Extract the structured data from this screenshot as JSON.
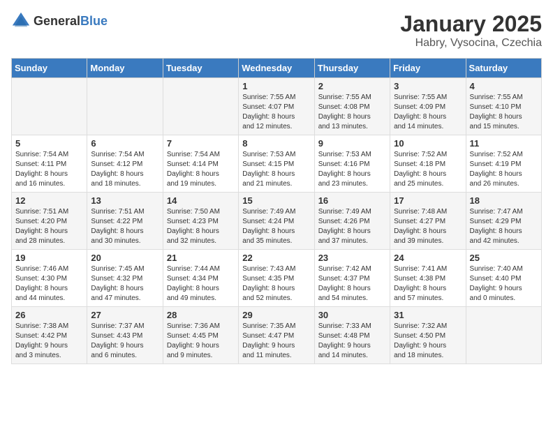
{
  "logo": {
    "text_general": "General",
    "text_blue": "Blue"
  },
  "header": {
    "month": "January 2025",
    "location": "Habry, Vysocina, Czechia"
  },
  "weekdays": [
    "Sunday",
    "Monday",
    "Tuesday",
    "Wednesday",
    "Thursday",
    "Friday",
    "Saturday"
  ],
  "weeks": [
    [
      {
        "day": "",
        "info": ""
      },
      {
        "day": "",
        "info": ""
      },
      {
        "day": "",
        "info": ""
      },
      {
        "day": "1",
        "info": "Sunrise: 7:55 AM\nSunset: 4:07 PM\nDaylight: 8 hours\nand 12 minutes."
      },
      {
        "day": "2",
        "info": "Sunrise: 7:55 AM\nSunset: 4:08 PM\nDaylight: 8 hours\nand 13 minutes."
      },
      {
        "day": "3",
        "info": "Sunrise: 7:55 AM\nSunset: 4:09 PM\nDaylight: 8 hours\nand 14 minutes."
      },
      {
        "day": "4",
        "info": "Sunrise: 7:55 AM\nSunset: 4:10 PM\nDaylight: 8 hours\nand 15 minutes."
      }
    ],
    [
      {
        "day": "5",
        "info": "Sunrise: 7:54 AM\nSunset: 4:11 PM\nDaylight: 8 hours\nand 16 minutes."
      },
      {
        "day": "6",
        "info": "Sunrise: 7:54 AM\nSunset: 4:12 PM\nDaylight: 8 hours\nand 18 minutes."
      },
      {
        "day": "7",
        "info": "Sunrise: 7:54 AM\nSunset: 4:14 PM\nDaylight: 8 hours\nand 19 minutes."
      },
      {
        "day": "8",
        "info": "Sunrise: 7:53 AM\nSunset: 4:15 PM\nDaylight: 8 hours\nand 21 minutes."
      },
      {
        "day": "9",
        "info": "Sunrise: 7:53 AM\nSunset: 4:16 PM\nDaylight: 8 hours\nand 23 minutes."
      },
      {
        "day": "10",
        "info": "Sunrise: 7:52 AM\nSunset: 4:18 PM\nDaylight: 8 hours\nand 25 minutes."
      },
      {
        "day": "11",
        "info": "Sunrise: 7:52 AM\nSunset: 4:19 PM\nDaylight: 8 hours\nand 26 minutes."
      }
    ],
    [
      {
        "day": "12",
        "info": "Sunrise: 7:51 AM\nSunset: 4:20 PM\nDaylight: 8 hours\nand 28 minutes."
      },
      {
        "day": "13",
        "info": "Sunrise: 7:51 AM\nSunset: 4:22 PM\nDaylight: 8 hours\nand 30 minutes."
      },
      {
        "day": "14",
        "info": "Sunrise: 7:50 AM\nSunset: 4:23 PM\nDaylight: 8 hours\nand 32 minutes."
      },
      {
        "day": "15",
        "info": "Sunrise: 7:49 AM\nSunset: 4:24 PM\nDaylight: 8 hours\nand 35 minutes."
      },
      {
        "day": "16",
        "info": "Sunrise: 7:49 AM\nSunset: 4:26 PM\nDaylight: 8 hours\nand 37 minutes."
      },
      {
        "day": "17",
        "info": "Sunrise: 7:48 AM\nSunset: 4:27 PM\nDaylight: 8 hours\nand 39 minutes."
      },
      {
        "day": "18",
        "info": "Sunrise: 7:47 AM\nSunset: 4:29 PM\nDaylight: 8 hours\nand 42 minutes."
      }
    ],
    [
      {
        "day": "19",
        "info": "Sunrise: 7:46 AM\nSunset: 4:30 PM\nDaylight: 8 hours\nand 44 minutes."
      },
      {
        "day": "20",
        "info": "Sunrise: 7:45 AM\nSunset: 4:32 PM\nDaylight: 8 hours\nand 47 minutes."
      },
      {
        "day": "21",
        "info": "Sunrise: 7:44 AM\nSunset: 4:34 PM\nDaylight: 8 hours\nand 49 minutes."
      },
      {
        "day": "22",
        "info": "Sunrise: 7:43 AM\nSunset: 4:35 PM\nDaylight: 8 hours\nand 52 minutes."
      },
      {
        "day": "23",
        "info": "Sunrise: 7:42 AM\nSunset: 4:37 PM\nDaylight: 8 hours\nand 54 minutes."
      },
      {
        "day": "24",
        "info": "Sunrise: 7:41 AM\nSunset: 4:38 PM\nDaylight: 8 hours\nand 57 minutes."
      },
      {
        "day": "25",
        "info": "Sunrise: 7:40 AM\nSunset: 4:40 PM\nDaylight: 9 hours\nand 0 minutes."
      }
    ],
    [
      {
        "day": "26",
        "info": "Sunrise: 7:38 AM\nSunset: 4:42 PM\nDaylight: 9 hours\nand 3 minutes."
      },
      {
        "day": "27",
        "info": "Sunrise: 7:37 AM\nSunset: 4:43 PM\nDaylight: 9 hours\nand 6 minutes."
      },
      {
        "day": "28",
        "info": "Sunrise: 7:36 AM\nSunset: 4:45 PM\nDaylight: 9 hours\nand 9 minutes."
      },
      {
        "day": "29",
        "info": "Sunrise: 7:35 AM\nSunset: 4:47 PM\nDaylight: 9 hours\nand 11 minutes."
      },
      {
        "day": "30",
        "info": "Sunrise: 7:33 AM\nSunset: 4:48 PM\nDaylight: 9 hours\nand 14 minutes."
      },
      {
        "day": "31",
        "info": "Sunrise: 7:32 AM\nSunset: 4:50 PM\nDaylight: 9 hours\nand 18 minutes."
      },
      {
        "day": "",
        "info": ""
      }
    ]
  ]
}
